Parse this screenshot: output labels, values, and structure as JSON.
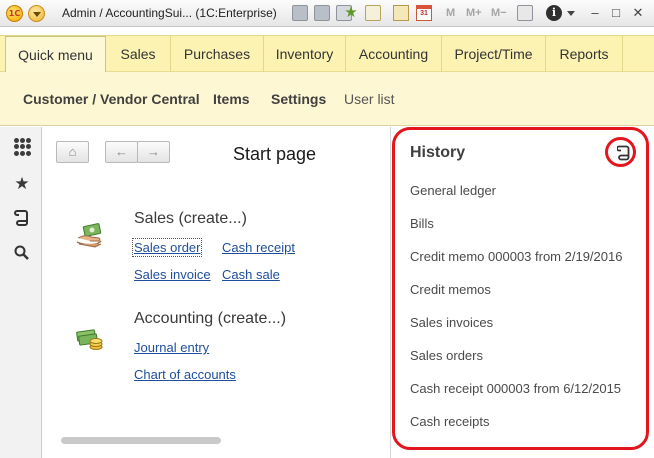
{
  "window": {
    "title": "Admin / AccountingSui...  (1C:Enterprise)",
    "logo_text": "1C",
    "calendar_day": "31",
    "memory_buttons": [
      "M",
      "M+",
      "M−"
    ],
    "info_glyph": "i",
    "minimize_glyph": "–",
    "restore_glyph": "□",
    "close_glyph": "✕"
  },
  "main_menu": {
    "items": [
      "Quick menu",
      "Sales",
      "Purchases",
      "Inventory",
      "Accounting",
      "Project/Time",
      "Reports"
    ],
    "active": "Quick menu"
  },
  "sub_menu": {
    "items": [
      "Customer / Vendor Central",
      "Items",
      "Settings"
    ],
    "extra": "User list"
  },
  "left_panel": {
    "icons": [
      "apps-grid-icon",
      "favorites-star-icon",
      "history-icon",
      "search-icon"
    ],
    "star_glyph": "★",
    "search_glyph": "⚲"
  },
  "start_page": {
    "title": "Start page",
    "home_glyph": "⌂",
    "back_glyph": "←",
    "forward_glyph": "→",
    "groups": [
      {
        "title": "Sales (create...)",
        "icon": "sales-money-icon",
        "links": [
          "Sales order",
          "Cash receipt",
          "Sales invoice",
          "Cash sale"
        ]
      },
      {
        "title": "Accounting (create...)",
        "icon": "accounting-coins-icon",
        "links": [
          "Journal entry",
          "Chart of accounts"
        ]
      }
    ]
  },
  "history": {
    "title": "History",
    "items": [
      "General ledger",
      "Bills",
      "Credit memo 000003 from 2/19/2016",
      "Credit memos",
      "Sales invoices",
      "Sales orders",
      "Cash receipt 000003 from 6/12/2015",
      "Cash receipts"
    ]
  },
  "colors": {
    "menu_bg": "#fcf3b3",
    "submenu_bg": "#fdf8d3",
    "link": "#1f4e9c",
    "highlight": "#e3161d"
  }
}
